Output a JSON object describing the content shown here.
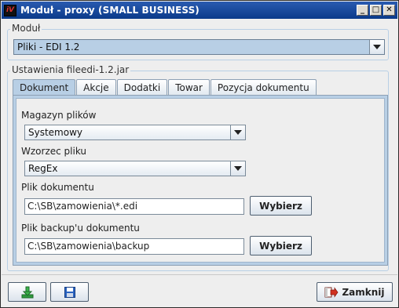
{
  "window": {
    "title": "Moduł - proxy (SMALL BUSINESS)",
    "icon_text": "iV",
    "minimize_glyph": "_",
    "maximize_glyph": "□",
    "close_glyph": "✕"
  },
  "module": {
    "legend": "Moduł",
    "selected": "Pliki - EDI 1.2"
  },
  "settings": {
    "legend": "Ustawienia fileedi-1.2.jar",
    "tabs": [
      {
        "label": "Dokument",
        "active": true
      },
      {
        "label": "Akcje",
        "active": false
      },
      {
        "label": "Dodatki",
        "active": false
      },
      {
        "label": "Towar",
        "active": false
      },
      {
        "label": "Pozycja dokumentu",
        "active": false
      }
    ]
  },
  "document_tab": {
    "warehouse_label": "Magazyn plików",
    "warehouse_value": "Systemowy",
    "pattern_label": "Wzorzec pliku",
    "pattern_value": "RegEx",
    "doc_file_label": "Plik dokumentu",
    "doc_file_value": "C:\\SB\\zamowienia\\*.edi",
    "doc_browse_label": "Wybierz",
    "backup_label": "Plik backup'u dokumentu",
    "backup_value": "C:\\SB\\zamowienia\\backup",
    "backup_browse_label": "Wybierz"
  },
  "footer": {
    "download_icon": "download-icon",
    "save_icon": "save-icon",
    "close_label": "Zamknij",
    "close_icon": "exit-icon"
  },
  "colors": {
    "titlebar": "#0a3a8a",
    "accent": "#b8cfe5",
    "download_green": "#2e9a3e",
    "save_blue": "#2a63c0",
    "exit_red": "#d03020"
  }
}
